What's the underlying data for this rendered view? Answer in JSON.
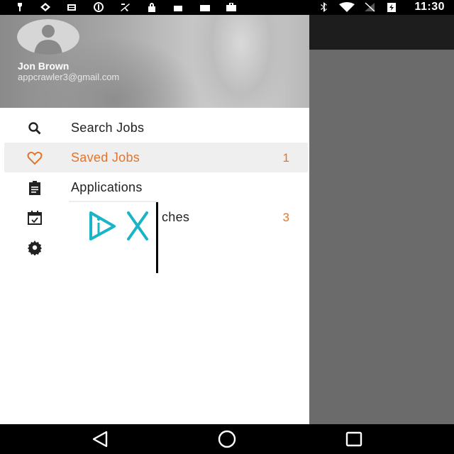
{
  "status_bar": {
    "time": "11:30",
    "icons_left": [
      "alarm-icon",
      "vpn-icon",
      "sim-icon",
      "blocked-icon",
      "fake-gps-icon",
      "lock-icon",
      "android-debug-icon",
      "download-done-icon",
      "briefcase-icon"
    ],
    "icons_right": [
      "bluetooth-icon",
      "wifi-icon",
      "no-signal-icon",
      "battery-charging-icon"
    ]
  },
  "drawer": {
    "user_name": "Jon Brown",
    "user_email": "appcrawler3@gmail.com",
    "items": [
      {
        "label": "Search Jobs",
        "count": "",
        "icon": "search-icon"
      },
      {
        "label": "Saved Jobs",
        "count": "1",
        "icon": "heart-icon",
        "selected": true
      },
      {
        "label": "Applications",
        "count": "",
        "icon": "clipboard-icon"
      },
      {
        "label": "ches",
        "count": "3",
        "icon": "calendar-check-icon"
      },
      {
        "label": "",
        "count": "",
        "icon": "settings-icon"
      }
    ]
  },
  "colors": {
    "accent": "#e4742a",
    "drawer_bg": "#ffffff",
    "scrim": "#6b6b6b",
    "app_bar": "#1d1d1d",
    "overlay_logo": "#19b4c6"
  },
  "nav_bar": {
    "buttons": [
      "back-icon",
      "home-icon",
      "recents-icon"
    ]
  }
}
